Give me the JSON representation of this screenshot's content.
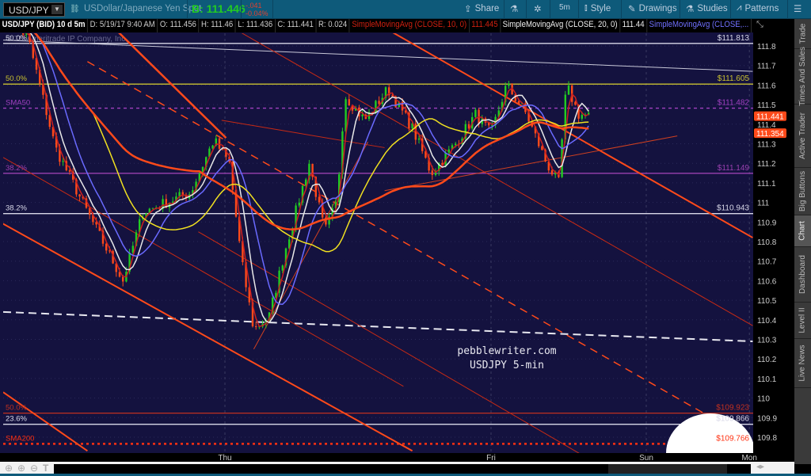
{
  "toolbar": {
    "symbol": "USD/JPY",
    "description": "USDollar/Japanese Yen Spot",
    "bid": "B: 111.446",
    "change": "-.041",
    "change_pct": "-0.04%",
    "share": "Share",
    "timeframe": "5m",
    "style": "Style",
    "drawings": "Drawings",
    "studies": "Studies",
    "patterns": "Patterns"
  },
  "infobar": {
    "title": "USD/JPY (BID) 10 d 5m",
    "date": "D: 5/19/17 9:40 AM",
    "open": "O: 111.456",
    "high": "H: 111.46",
    "low": "L: 111.436",
    "close": "C: 111.441",
    "range": "R: 0.024",
    "sma10_label": "SimpleMovingAvg (CLOSE, 10, 0)",
    "sma10_value": "111.445",
    "sma20_label": "SimpleMovingAvg (CLOSE, 20, 0)",
    "sma20_value": "111.44",
    "sma_more_label": "SimpleMovingAvg (CLOSE,..."
  },
  "right_tabs": [
    "Trade",
    "Times And Sales",
    "Active Trader",
    "Big Buttons",
    "Chart",
    "Dashboard",
    "Level II",
    "Live News"
  ],
  "colors": {
    "plot_bg": "#14123f",
    "up": "#22cc22",
    "down": "#ff4a1a",
    "accent": "#ff4a1a"
  },
  "chart_data": {
    "type": "line",
    "title": "USD/JPY (BID) 10 d 5m",
    "watermark": "© TD Ameritrade IP Company, Inc.",
    "annotation": [
      "pebblewriter.com",
      "USDJPY 5-min"
    ],
    "x_unit": "hours from Thu 00:00",
    "xlim": [
      -20.3,
      47.4
    ],
    "ylim": [
      109.73,
      111.87
    ],
    "x_ticks": [
      {
        "t": 0,
        "label": "Thu"
      },
      {
        "t": 24,
        "label": "Fri"
      },
      {
        "t": 38,
        "label": "Sun"
      },
      {
        "t": 47.3,
        "label": "Mon"
      }
    ],
    "y_ticks": [
      "109.8",
      "109.9",
      "110",
      "110.1",
      "110.2",
      "110.3",
      "110.4",
      "110.5",
      "110.6",
      "110.7",
      "110.8",
      "110.9",
      "111",
      "111.1",
      "111.2",
      "111.3",
      "111.4",
      "111.5",
      "111.6",
      "111.7",
      "111.8"
    ],
    "price_keypoints": [
      [
        -20,
        111.95
      ],
      [
        -17.8,
        111.85
      ],
      [
        -15.3,
        111.28
      ],
      [
        -12.4,
        110.95
      ],
      [
        -9.2,
        110.6
      ],
      [
        -7.4,
        110.95
      ],
      [
        -5.3,
        111.0
      ],
      [
        -3.1,
        111.05
      ],
      [
        -1.0,
        111.32
      ],
      [
        0.4,
        111.2
      ],
      [
        1.5,
        110.7
      ],
      [
        2.6,
        110.35
      ],
      [
        4.0,
        110.42
      ],
      [
        5.4,
        110.75
      ],
      [
        7.6,
        111.2
      ],
      [
        9.0,
        110.85
      ],
      [
        10.1,
        111.0
      ],
      [
        10.8,
        111.55
      ],
      [
        12.6,
        111.42
      ],
      [
        14.7,
        111.58
      ],
      [
        16.9,
        111.38
      ],
      [
        18.6,
        111.15
      ],
      [
        20.8,
        111.3
      ],
      [
        22.6,
        111.45
      ],
      [
        24.0,
        111.35
      ],
      [
        25.4,
        111.6
      ],
      [
        27.2,
        111.45
      ],
      [
        29.0,
        111.2
      ],
      [
        30.1,
        111.1
      ],
      [
        30.8,
        111.6
      ],
      [
        31.9,
        111.45
      ],
      [
        33.1,
        111.44
      ]
    ],
    "series": [
      {
        "name": "SMA 10",
        "color": "#cc2020",
        "period": 3
      },
      {
        "name": "SMA 20",
        "color": "#e8e8e8",
        "period": 6
      },
      {
        "name": "SMA (blue)",
        "color": "#6a6aff",
        "period": 12
      },
      {
        "name": "SMA (yellow)",
        "color": "#f0e020",
        "period": 28
      },
      {
        "name": "SMA50",
        "color": "#ff4a1a",
        "period": 60
      }
    ],
    "levels": [
      {
        "price": 111.813,
        "label_left": "50.0%",
        "label_right": "$111.813",
        "color": "#d8d8e8",
        "style": "solid"
      },
      {
        "price": 111.605,
        "label_left": "50.0%",
        "label_right": "$111.605",
        "color": "#c8c030",
        "style": "solid"
      },
      {
        "price": 111.482,
        "label_left": "SMA50",
        "label_right": "$111.482",
        "color": "#a040c0",
        "style": "dashed"
      },
      {
        "price": 111.149,
        "label_left": "38.2%",
        "label_right": "$111.149",
        "color": "#9a40b0",
        "style": "solid"
      },
      {
        "price": 110.943,
        "label_left": "38.2%",
        "label_right": "$110.943",
        "color": "#d8d8e8",
        "style": "solid"
      },
      {
        "price": 109.923,
        "label_left": "50.0%",
        "label_right": "$109.923",
        "color": "#c03020",
        "style": "solid"
      },
      {
        "price": 109.866,
        "label_left": "23.6%",
        "label_right": "$109.866",
        "color": "#d8d8e8",
        "style": "solid"
      },
      {
        "price": 109.766,
        "label_left": "SMA200",
        "label_right": "$109.766",
        "color": "#ff3010",
        "style": "dotted"
      }
    ],
    "trendlines": [
      {
        "name": "white-resistance",
        "from": [
          -20,
          111.83
        ],
        "to": [
          47.6,
          111.67
        ],
        "color": "#c8c8d8",
        "width": 1,
        "dash": ""
      },
      {
        "name": "white-dashed-support",
        "from": [
          -20,
          110.44
        ],
        "to": [
          47.6,
          110.29
        ],
        "color": "#e8e8f0",
        "width": 2,
        "dash": "10 6"
      },
      {
        "name": "orange-channel-lower",
        "from": [
          -20.3,
          110.9
        ],
        "to": [
          16.9,
          109.73
        ],
        "color": "#ff4a1a",
        "width": 2,
        "dash": ""
      },
      {
        "name": "orange-channel-lower-2",
        "from": [
          -20,
          110.03
        ],
        "to": [
          -12.4,
          109.73
        ],
        "color": "#ff4a1a",
        "width": 2,
        "dash": ""
      },
      {
        "name": "orange-channel-upper",
        "from": [
          15.1,
          111.87
        ],
        "to": [
          47.6,
          110.82
        ],
        "color": "#ff4a1a",
        "width": 2,
        "dash": ""
      },
      {
        "name": "orange-steep",
        "from": [
          -9.6,
          111.87
        ],
        "to": [
          0.1,
          111.33
        ],
        "color": "#ff4a1a",
        "width": 2.5,
        "dash": ""
      },
      {
        "name": "orange-dashed-mid",
        "from": [
          -12.4,
          111.72
        ],
        "to": [
          47.6,
          109.78
        ],
        "color": "#ff4a1a",
        "width": 1.5,
        "dash": "10 7"
      },
      {
        "name": "red-thin-1",
        "from": [
          1.4,
          111.87
        ],
        "to": [
          47.6,
          110.37
        ],
        "color": "#c82a14",
        "width": 1,
        "dash": ""
      },
      {
        "name": "red-thin-2",
        "from": [
          -20,
          111.23
        ],
        "to": [
          16.1,
          110.06
        ],
        "color": "#c82a14",
        "width": 1,
        "dash": ""
      },
      {
        "name": "red-thin-3",
        "from": [
          -2.4,
          110.85
        ],
        "to": [
          34,
          109.65
        ],
        "color": "#c82a14",
        "width": 1,
        "dash": ""
      },
      {
        "name": "red-thin-4",
        "from": [
          -0.3,
          111.42
        ],
        "to": [
          14.4,
          111.28
        ],
        "color": "#c82a14",
        "width": 1,
        "dash": ""
      },
      {
        "name": "rising-support",
        "from": [
          14.4,
          111.06
        ],
        "to": [
          40.8,
          111.34
        ],
        "color": "#d04020",
        "width": 1,
        "dash": ""
      },
      {
        "name": "rising-support-2",
        "from": [
          2.6,
          110.25
        ],
        "to": [
          12.9,
          111.31
        ],
        "color": "#d04020",
        "width": 1,
        "dash": ""
      }
    ],
    "price_tags": [
      {
        "value": "111.441",
        "price": 111.441
      },
      {
        "value": "111.354",
        "price": 111.354
      }
    ]
  }
}
